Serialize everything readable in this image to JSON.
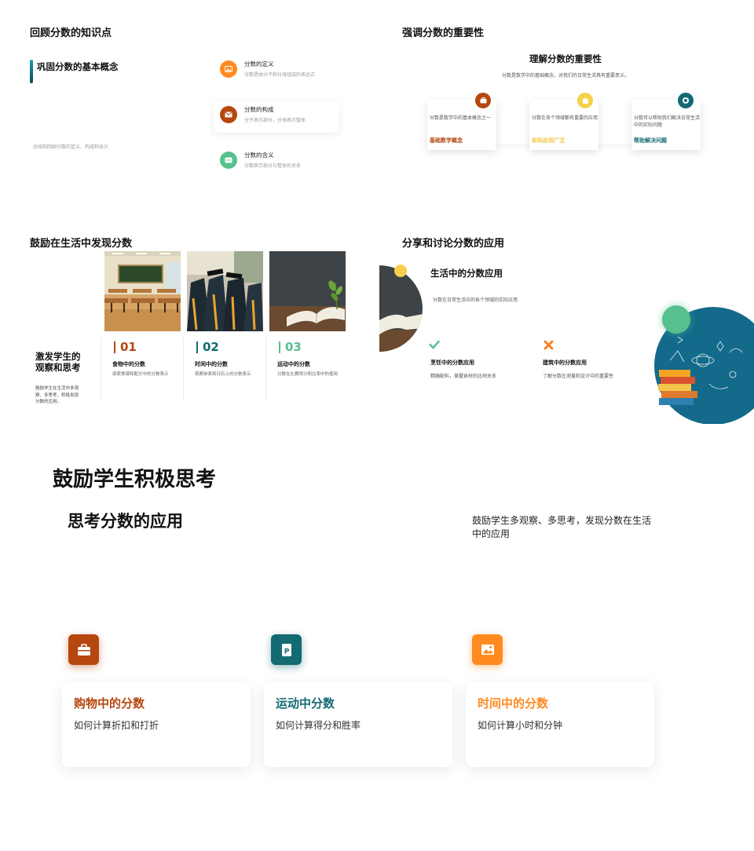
{
  "slide1": {
    "title": "回顾分数的知识点",
    "subtitle": "巩固分数的基本概念",
    "note": "总结和回顾分数的定义、构成和含义",
    "items": [
      {
        "title": "分数的定义",
        "desc": "分数是由分子和分母组成的表达式",
        "icon": "image-icon",
        "color": "#ff8a1f"
      },
      {
        "title": "分数的构成",
        "desc": "分子表示部分，分母表示整体",
        "icon": "envelope-icon",
        "color": "#b5470f"
      },
      {
        "title": "分数的含义",
        "desc": "分数表示部分与整体的关系",
        "icon": "chat-icon",
        "color": "#56c08e"
      }
    ]
  },
  "slide2": {
    "title": "强调分数的重要性",
    "heading": "理解分数的重要性",
    "desc": "分数是数学中的基础概念，对我们的日常生活具有重要意义。",
    "cards": [
      {
        "text": "分数是数学中的基本概念之一",
        "label": "基础数学概念",
        "color": "#b5470f",
        "icon": "briefcase-icon"
      },
      {
        "text": "分数在各个领域都有重要的应用",
        "label": "实际应用广泛",
        "color": "#f5c33b",
        "icon": "puzzle-icon"
      },
      {
        "text": "分数可以帮助我们解决日常生活中的实际问题",
        "label": "帮助解决问题",
        "color": "#136a73",
        "icon": "target-icon"
      }
    ]
  },
  "slide3": {
    "title": "鼓励在生活中发现分数",
    "left_title": "激发学生的观察和思考",
    "left_desc": "鼓励学生在生活中多观察、多思考，积极发现分数的应用。",
    "cards": [
      {
        "num": "01",
        "title": "食物中的分数",
        "desc": "探索食谱和配方中的分数表示",
        "color": "#b5470f",
        "photo": "classroom-photo"
      },
      {
        "num": "02",
        "title": "时间中的分数",
        "desc": "观察钟表和日历上的分数表示",
        "color": "#136a73",
        "photo": "graduation-photo"
      },
      {
        "num": "03",
        "title": "运动中的分数",
        "desc": "分数在比赛得分和比率中的使用",
        "color": "#56c08e",
        "photo": "book-photo"
      }
    ]
  },
  "slide4": {
    "title": "分享和讨论分数的应用",
    "subtitle": "生活中的分数应用",
    "desc": "分数在日常生活中的各个领域的实际应用",
    "items": [
      {
        "title": "烹饪中的分数应用",
        "desc": "精确配料，掌握食材的比例关系",
        "icon": "check-icon",
        "color": "#56c08e"
      },
      {
        "title": "建筑中的分数应用",
        "desc": "了解分数在测量和设计中的重要性",
        "icon": "cross-icon",
        "color": "#ff7a1a"
      }
    ]
  },
  "slide5": {
    "title": "鼓励学生积极思考",
    "subtitle": "思考分数的应用",
    "desc": "鼓励学生多观察、多思考，发现分数在生活中的应用",
    "cards": [
      {
        "title": "购物中的分数",
        "desc": "如何计算折扣和打折",
        "color": "#b5470f",
        "icon": "briefcase-icon"
      },
      {
        "title": "运动中分数",
        "desc": "如何计算得分和胜率",
        "color": "#136a73",
        "icon": "p-document-icon",
        "icon_letter": "P"
      },
      {
        "title": "时间中的分数",
        "desc": "如何计算小时和分钟",
        "color": "#ff8a1f",
        "icon": "image-icon"
      }
    ]
  }
}
